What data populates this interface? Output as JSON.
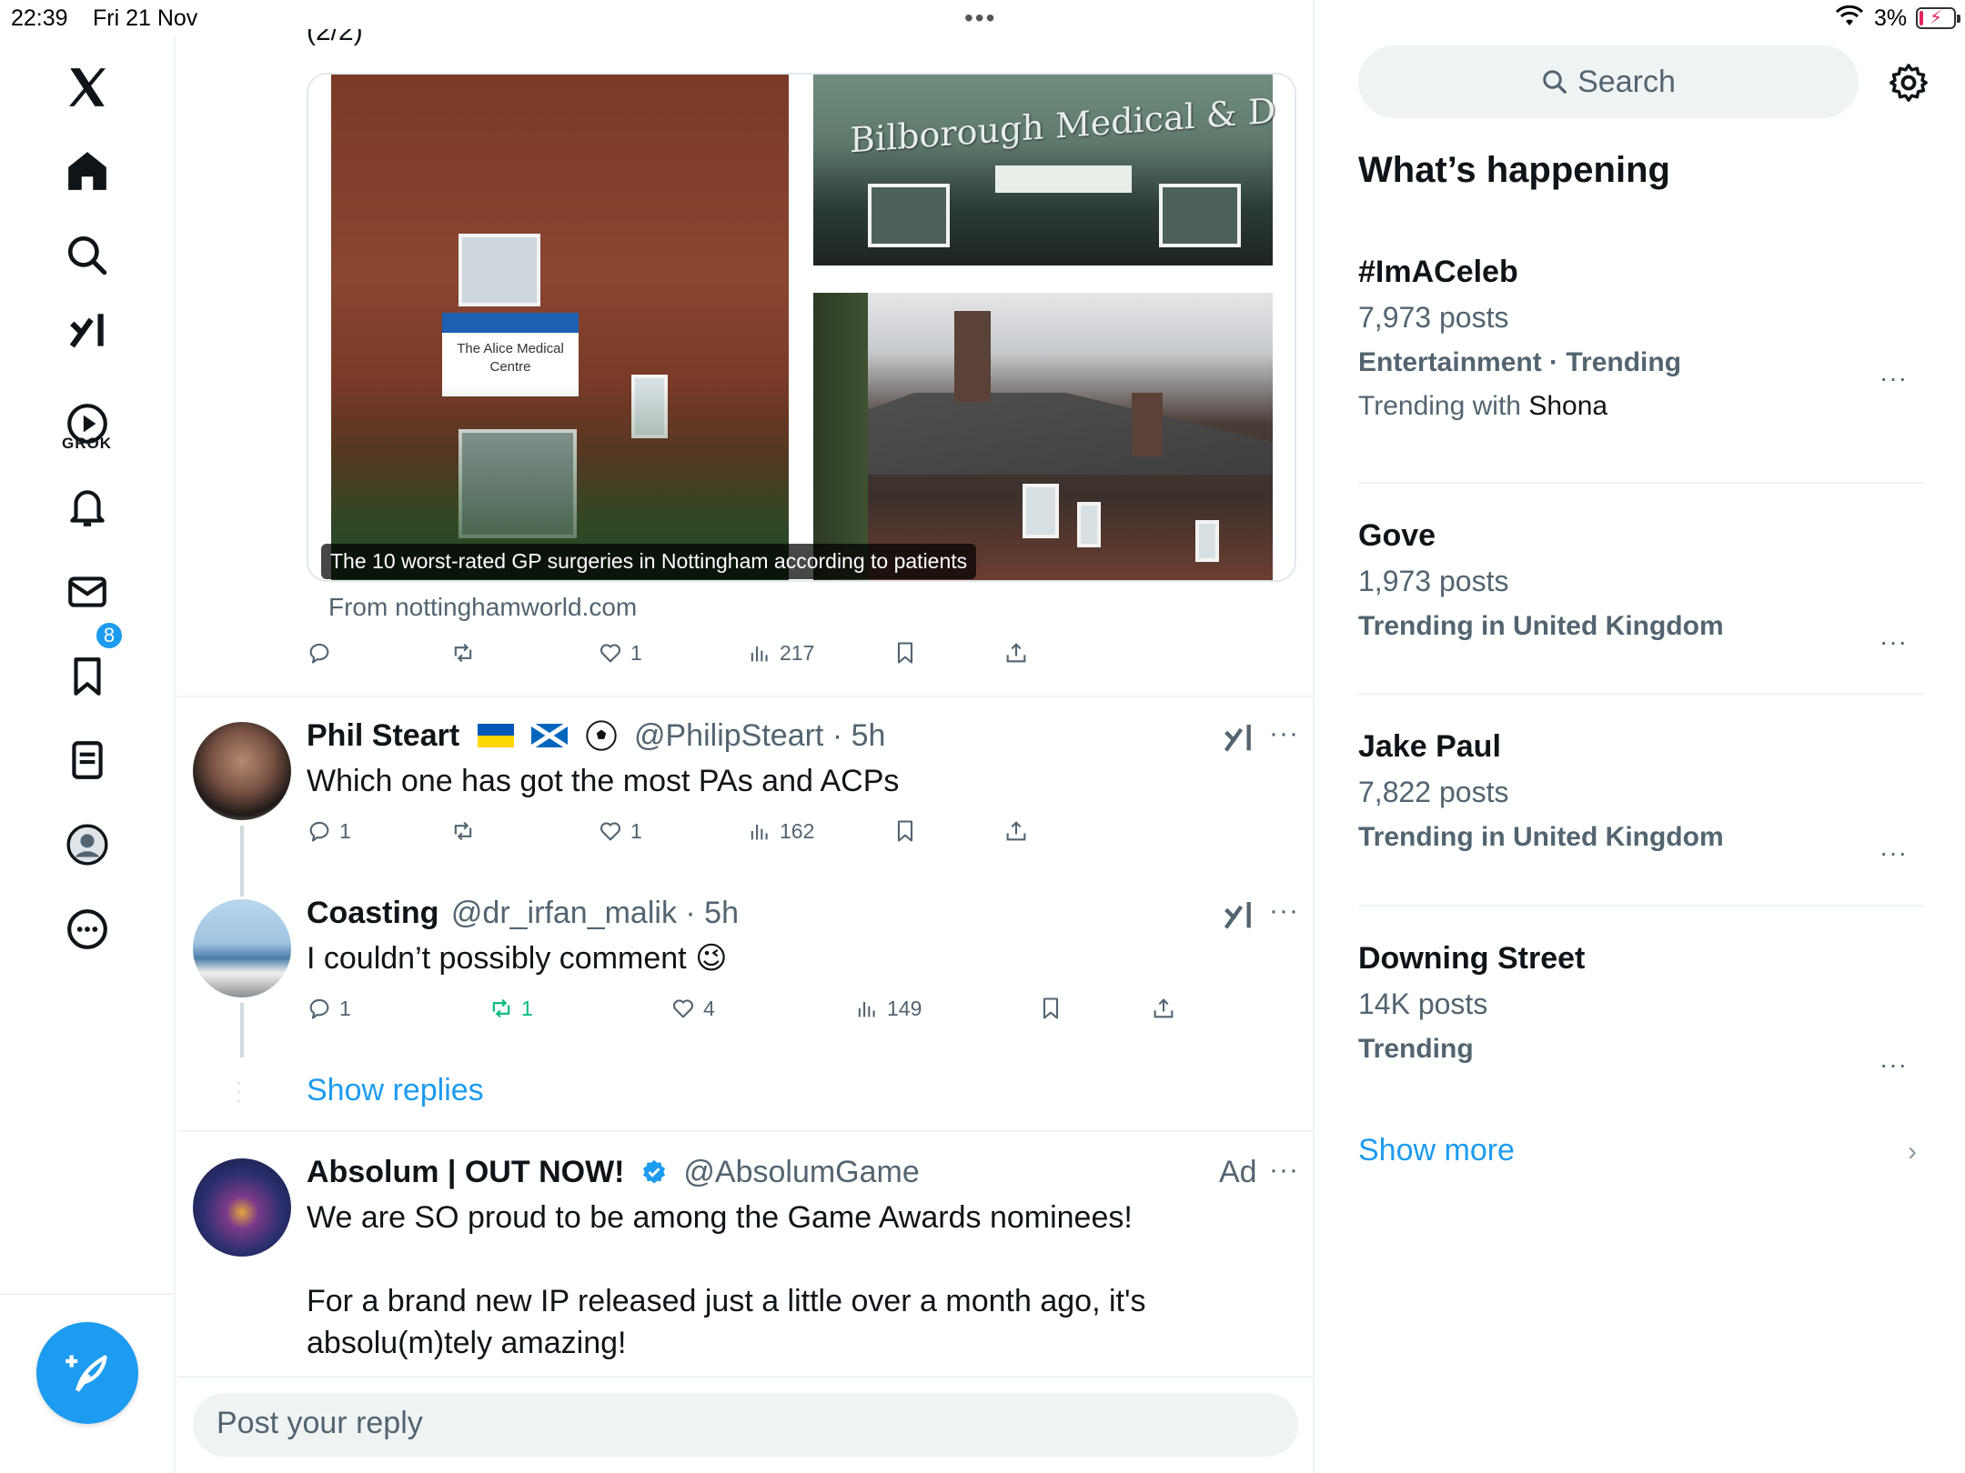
{
  "status_bar": {
    "time": "22:39",
    "date": "Fri 21 Nov",
    "battery": "3%"
  },
  "nav": {
    "logo": "x-logo-icon",
    "items": [
      "home-icon",
      "search-icon",
      "grok-icon",
      "video-icon",
      "bell-icon",
      "mail-icon",
      "bookmark-icon",
      "lists-icon",
      "profile-icon",
      "more-icon"
    ],
    "grok_label": "GROK",
    "notification_count": "8"
  },
  "thread": {
    "cut_text": "(2/2)",
    "card": {
      "caption": "The 10 worst-rated GP surgeries in Nottingham according to patients",
      "source": "From nottinghamworld.com",
      "sign_nhs": "NHS",
      "sign_text": "The Alice Medical Centre",
      "sign_bilborough": "Bilborough Medical & D"
    },
    "first_actions": {
      "replies": "",
      "reposts": "",
      "likes": "1",
      "views": "217"
    }
  },
  "replies": [
    {
      "name": "Phil Steart",
      "handle": "@PhilipSteart",
      "time": "5h",
      "text": "Which one has got the most PAs and ACPs",
      "stats": {
        "replies": "1",
        "reposts": "",
        "likes": "1",
        "views": "162"
      }
    },
    {
      "name": "Coasting",
      "handle": "@dr_irfan_malik",
      "time": "5h",
      "text": "I couldn’t possibly comment 😉",
      "stats": {
        "replies": "1",
        "reposts": "1",
        "likes": "4",
        "views": "149"
      }
    }
  ],
  "show_replies": "Show replies",
  "ad_tweet": {
    "name": "Absolum | OUT NOW!",
    "handle": "@AbsolumGame",
    "ad_label": "Ad",
    "line1": "We are SO proud to be among the Game Awards nominees!",
    "line2": "For a brand new IP released just a little over a month ago, it's absolu(m)tely amazing!"
  },
  "reply_placeholder": "Post your reply",
  "sidebar": {
    "search_placeholder": "Search",
    "title": "What’s happening",
    "trends": [
      {
        "name": "#ImACeleb",
        "posts": "7,973 posts",
        "context": "Entertainment · Trending",
        "with_prefix": "Trending with",
        "with_name": "Shona"
      },
      {
        "name": "Gove",
        "posts": "1,973 posts",
        "context": "Trending in United Kingdom"
      },
      {
        "name": "Jake Paul",
        "posts": "7,822 posts",
        "context": "Trending in United Kingdom"
      },
      {
        "name": "Downing Street",
        "posts": "14K posts",
        "context": "Trending"
      }
    ],
    "show_more": "Show more"
  },
  "colors": {
    "accent": "#1d9bf0",
    "text": "#0f1419",
    "secondary": "#536471",
    "repost_green": "#00ba7c"
  }
}
